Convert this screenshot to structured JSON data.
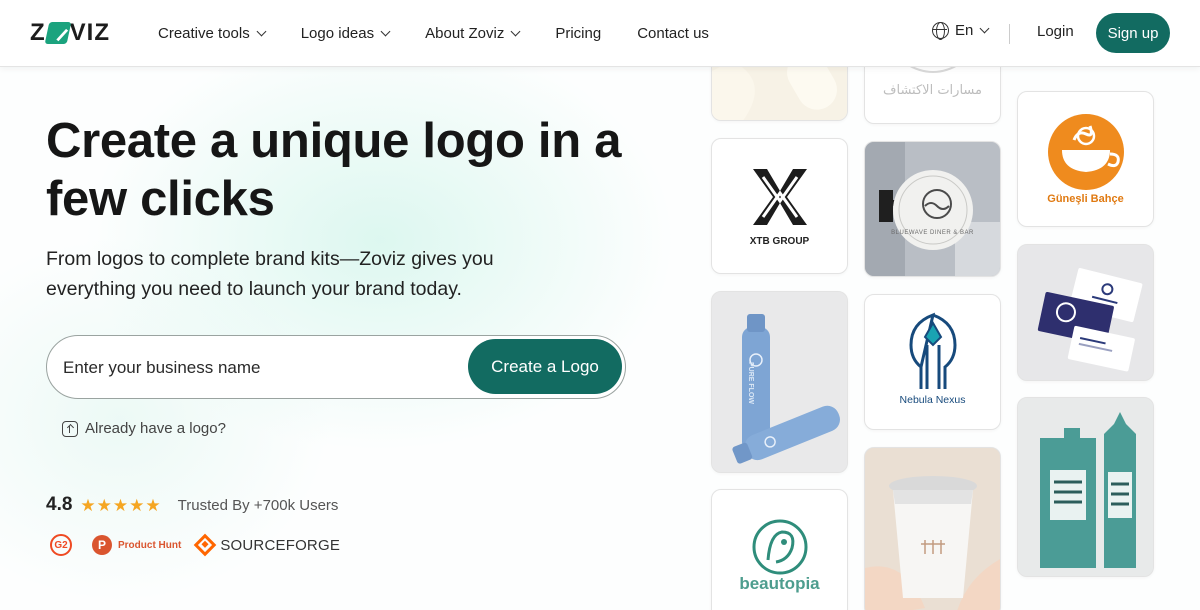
{
  "header": {
    "brand": "ZOVIZ",
    "nav": [
      {
        "label": "Creative tools",
        "dropdown": true
      },
      {
        "label": "Logo ideas",
        "dropdown": true
      },
      {
        "label": "About Zoviz",
        "dropdown": true
      },
      {
        "label": "Pricing",
        "dropdown": false
      },
      {
        "label": "Contact us",
        "dropdown": false
      }
    ],
    "language": "En",
    "login_label": "Login",
    "signup_label": "Sign up"
  },
  "hero": {
    "title": "Create a unique logo in a few clicks",
    "subtitle": "From logos to complete brand kits—Zoviz gives you everything you need to launch your brand today.",
    "search_placeholder": "Enter your business name",
    "search_value": "",
    "cta_label": "Create a Logo",
    "upload_link": "Already have a logo?"
  },
  "social_proof": {
    "rating": "4.8",
    "stars": 5,
    "trusted_text": "Trusted By +700k Users",
    "badges": [
      "G2",
      "Product Hunt",
      "SOURCEFORGE"
    ]
  },
  "gallery": {
    "tiles": [
      {
        "label": "XTB GROUP",
        "kind": "logo-xtb"
      },
      {
        "label": "مسارات الاكتشاف",
        "kind": "logo-arabic"
      },
      {
        "label": "Güneşli Bahçe",
        "kind": "logo-coffee"
      },
      {
        "label": "BLUEWAVE DINER & BAR",
        "kind": "signage"
      },
      {
        "label": "",
        "kind": "business-cards"
      },
      {
        "label": "PURE FLOW",
        "kind": "bottles"
      },
      {
        "label": "Nebula Nexus",
        "kind": "logo-nebula"
      },
      {
        "label": "",
        "kind": "coffee-bags"
      },
      {
        "label": "beautopia",
        "kind": "logo-beautopia"
      },
      {
        "label": "",
        "kind": "coffee-cup"
      }
    ]
  },
  "colors": {
    "primary": "#126b61",
    "brand_green": "#1ba37e",
    "star": "#f5a623"
  }
}
